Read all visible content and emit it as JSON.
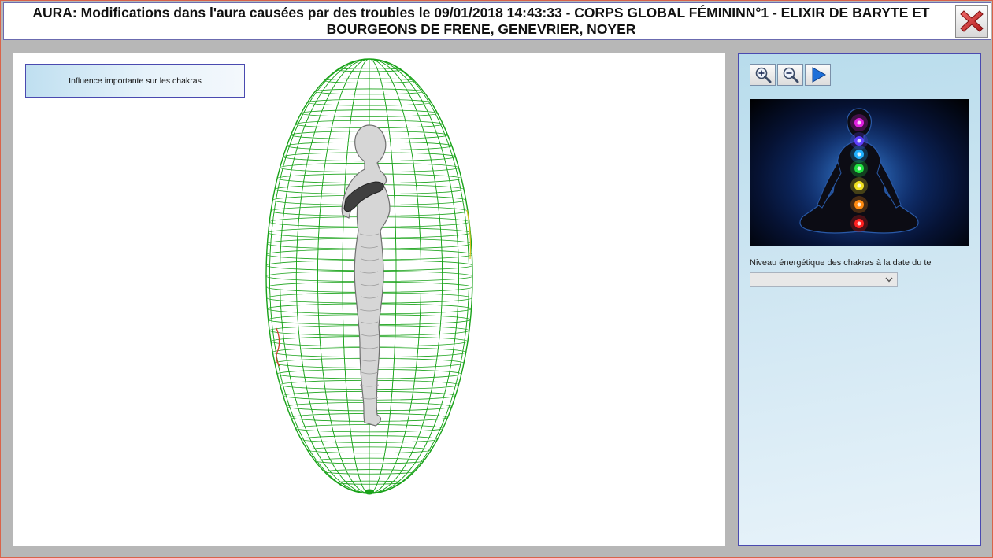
{
  "window": {
    "title": "AURA: Modifications dans l'aura causées par des troubles le 09/01/2018 14:43:33 - CORPS GLOBAL FÉMININN°1 - ELIXIR DE BARYTE ET BOURGEONS DE FRENE, GENEVRIER, NOYER",
    "close_icon": "close-x-icon"
  },
  "canvas": {
    "info_label": "Influence importante sur les chakras",
    "aura_color": "#1aa31a",
    "disturbance_colors": [
      "#d23a2a",
      "#d8c020"
    ]
  },
  "side_panel": {
    "toolbar": [
      {
        "icon": "zoom-in-icon"
      },
      {
        "icon": "zoom-out-icon"
      },
      {
        "icon": "play-icon"
      }
    ],
    "chakra_label": "Niveau énergétique des chakras à la date du te",
    "chakra_select_value": "",
    "chakra_colors": [
      "#e020e0",
      "#6040ff",
      "#20b0ff",
      "#20e040",
      "#f0e020",
      "#ff8a10",
      "#ff2020"
    ]
  }
}
